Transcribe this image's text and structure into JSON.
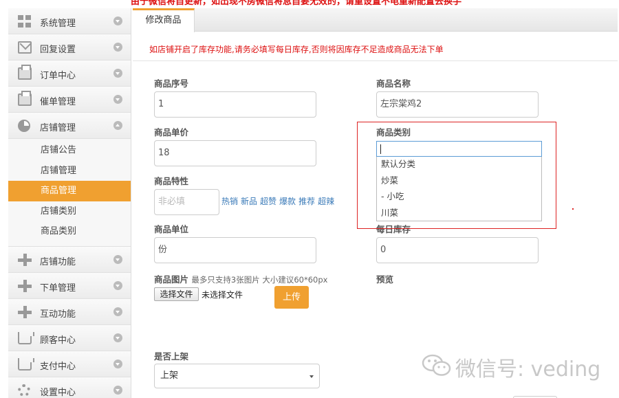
{
  "top_notice": "由于微信将自更新，如出现不房微信将息自要无效的，请重设置不电重新配置去换手",
  "sidebar": {
    "items": [
      {
        "label": "系统管理",
        "icon": "grid-icon"
      },
      {
        "label": "回复设置",
        "icon": "mail-icon"
      },
      {
        "label": "订单中心",
        "icon": "printer-icon"
      },
      {
        "label": "催单管理",
        "icon": "printer-icon"
      },
      {
        "label": "店铺管理",
        "icon": "pie-chart-icon"
      },
      {
        "label": "店铺功能",
        "icon": "plus-icon"
      },
      {
        "label": "下单管理",
        "icon": "plus-icon"
      },
      {
        "label": "互动功能",
        "icon": "plus-icon"
      },
      {
        "label": "顾客中心",
        "icon": "tray-icon"
      },
      {
        "label": "支付中心",
        "icon": "tray-icon"
      },
      {
        "label": "设置中心",
        "icon": "gear-icon"
      }
    ],
    "submenu": [
      "店铺公告",
      "店铺管理",
      "商品管理",
      "店铺类别",
      "商品类别"
    ],
    "active_sub": "商品管理"
  },
  "tab": {
    "label": "修改商品"
  },
  "warning": "如店铺开启了库存功能,请务必填写每日库存,否则将因库存不足造成商品无法下单",
  "form": {
    "index_label": "商品序号",
    "index_value": "1",
    "name_label": "商品名称",
    "name_value": "左宗棠鸡2",
    "price_label": "商品单价",
    "price_value": "18",
    "category_label": "商品类别",
    "feature_label": "商品特性",
    "feature_placeholder": "非必填",
    "feature_tags": [
      "热销",
      "新品",
      "超赞",
      "爆款",
      "推荐",
      "超辣"
    ],
    "unit_label": "商品单位",
    "unit_value": "份",
    "stock_label": "每日库存",
    "stock_value": "0",
    "image_label": "商品图片",
    "image_hint": "最多只支持3张图片 大小建议60*60px",
    "file_button": "选择文件",
    "file_status": "未选择文件",
    "upload_button": "上传",
    "preview_label": "预览",
    "onshelf_label": "是否上架",
    "onshelf_value": "上架"
  },
  "category_dropdown": {
    "search_value": "",
    "options": [
      "默认分类",
      "炒菜",
      "- 小吃",
      "川菜"
    ]
  },
  "watermark": "微信号: veding",
  "colors": {
    "accent": "#f0a030",
    "warning": "#dd1111",
    "link": "#3a7ab8"
  }
}
